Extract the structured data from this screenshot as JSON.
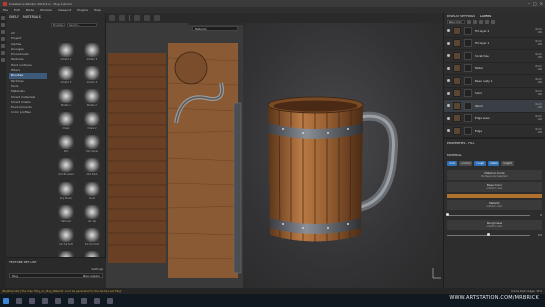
{
  "window": {
    "title": "Substance Painter 2018.2.0 - Mug tutorial"
  },
  "menu": [
    "File",
    "Edit",
    "Mode",
    "Window",
    "Viewport",
    "Plugins",
    "Help"
  ],
  "shelf": {
    "tabs": [
      "SHELF",
      "MATERIALS"
    ],
    "search_filter": "Brushes",
    "search_placeholder": "Search...",
    "categories": [
      "All",
      "Project",
      "Alphas",
      "Grunges",
      "Procedurals",
      "Textures",
      "Hard surfaces",
      "Filters",
      "Brushes",
      "Particles",
      "Tools",
      "Materials",
      "Smart materials",
      "Smart masks",
      "Environments",
      "Color profiles"
    ],
    "selected_category": "Brushes",
    "brushes": [
      "Artistic 1",
      "Artistic 2",
      "Artistic 3",
      "Artistic 4",
      "Bristle 1",
      "Bristle 2",
      "Chalk",
      "Chalk 2",
      "Dirt",
      "Dirt Spots",
      "Dirt Brushed",
      "Dirt Dust",
      "Dry Brush",
      "Dust",
      "Hatched",
      "Ink Tip",
      "Ink Tip Soft",
      "Ink Tip Hard",
      "Fibers Dense",
      "Fibers Sparse"
    ]
  },
  "texture_set_list": {
    "title": "TEXTURE SET LIST",
    "settings_label": "Settings",
    "mug_label": "Mug",
    "shader_label": "Main shader"
  },
  "viewport": {
    "left_dropdown": "Material",
    "right_dropdown": "Material"
  },
  "layers": {
    "tabs": [
      "DISPLAY SETTINGS",
      "LAYERS"
    ],
    "blend_dropdown": "Base Color",
    "items": [
      {
        "name": "Fill layer 2",
        "blend": "Norm",
        "opacity": "100"
      },
      {
        "name": "Fill layer 1",
        "blend": "Norm",
        "opacity": "100"
      },
      {
        "name": "Scratches",
        "blend": "Norm",
        "opacity": "100"
      },
      {
        "name": "Metal",
        "blend": "Norm",
        "opacity": "100"
      },
      {
        "name": "Base rusty 1",
        "blend": "Norm",
        "opacity": "100"
      },
      {
        "name": "Solid",
        "blend": "Norm",
        "opacity": "100"
      },
      {
        "name": "Wood",
        "blend": "Norm",
        "opacity": "100"
      },
      {
        "name": "Edge wear",
        "blend": "Norm",
        "opacity": "100"
      },
      {
        "name": "Edge",
        "blend": "Norm",
        "opacity": "100"
      }
    ],
    "selected_index": 6
  },
  "properties": {
    "title": "PROPERTIES - FILL",
    "section_material": "MATERIAL",
    "chips": [
      "color",
      "normal",
      "rough",
      "metal",
      "height"
    ],
    "chips_on": [
      true,
      false,
      true,
      true,
      false
    ],
    "material_mode_label": "Material mode",
    "material_mode_value": "No Resource Selected",
    "base_color_label": "Base Color",
    "base_color_sub": "uniform color",
    "base_color_hex": "#b0712f",
    "metallic_label": "Metallic",
    "metallic_sub": "uniform color",
    "metallic_value": "0",
    "metallic_level": 0.0,
    "roughness_label": "Roughness",
    "roughness_sub": "uniform color",
    "roughness_value": "0.5",
    "roughness_level": 0.5
  },
  "status": {
    "message": "[MapExporter] The map 'Mug_Ao_Mug_Material' can't be generated for the texture set 'Mug'",
    "cache": "Cache Disk Usage: 31%"
  },
  "watermark": "WWW.ARTSTATION.COM/MRBRICK"
}
